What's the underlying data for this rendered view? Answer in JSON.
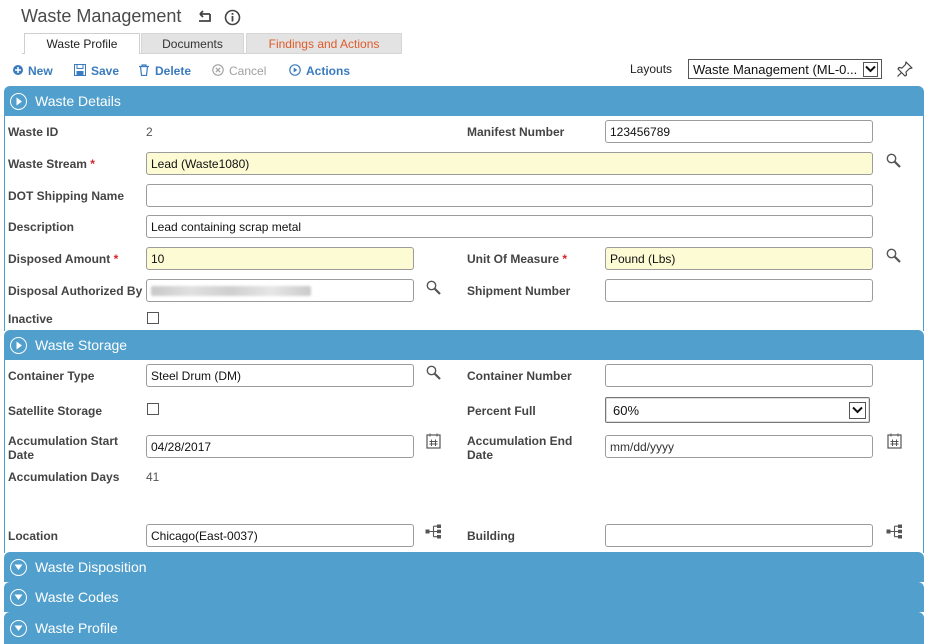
{
  "page": {
    "title": "Waste Management"
  },
  "tabs": [
    {
      "label": "Waste Profile",
      "active": true
    },
    {
      "label": "Documents",
      "active": false
    },
    {
      "label": "Findings and Actions",
      "active": false
    }
  ],
  "toolbar": {
    "new_label": "New",
    "save_label": "Save",
    "delete_label": "Delete",
    "cancel_label": "Cancel",
    "actions_label": "Actions",
    "layouts_label": "Layouts",
    "layouts_value": "Waste Management (ML-0..."
  },
  "sections": {
    "details": "Waste Details",
    "storage": "Waste Storage",
    "disposition": "Waste Disposition",
    "codes": "Waste Codes",
    "profile": "Waste Profile"
  },
  "details": {
    "waste_id_label": "Waste ID",
    "waste_id_value": "2",
    "manifest_label": "Manifest Number",
    "manifest_value": "123456789",
    "stream_label": "Waste Stream",
    "stream_value": "Lead (Waste1080)",
    "dot_label": "DOT Shipping Name",
    "dot_value": "",
    "description_label": "Description",
    "description_value": "Lead containing scrap metal",
    "disposed_amount_label": "Disposed Amount",
    "disposed_amount_value": "10",
    "uom_label": "Unit Of Measure",
    "uom_value": "Pound (Lbs)",
    "authorized_label": "Disposal Authorized By",
    "shipment_label": "Shipment Number",
    "shipment_value": "",
    "inactive_label": "Inactive",
    "required_mark": "*"
  },
  "storage": {
    "container_type_label": "Container Type",
    "container_type_value": "Steel Drum (DM)",
    "container_number_label": "Container Number",
    "container_number_value": "",
    "satellite_label": "Satellite Storage",
    "percent_full_label": "Percent Full",
    "percent_full_value": "60%",
    "accum_start_label_1": "Accumulation Start",
    "accum_start_label_2": "Date",
    "accum_start_value": "04/28/2017",
    "accum_end_label_1": "Accumulation End",
    "accum_end_label_2": "Date",
    "accum_end_placeholder": "mm/dd/yyyy",
    "accum_days_label": "Accumulation Days",
    "accum_days_value": "41",
    "location_label": "Location",
    "location_value": "Chicago(East-0037)",
    "building_label": "Building",
    "building_value": ""
  },
  "colors": {
    "section_bg": "#519fcd",
    "required_bg": "#fdfbd3",
    "link": "#3a7bbf",
    "findings_tab": "#e05a2a"
  }
}
